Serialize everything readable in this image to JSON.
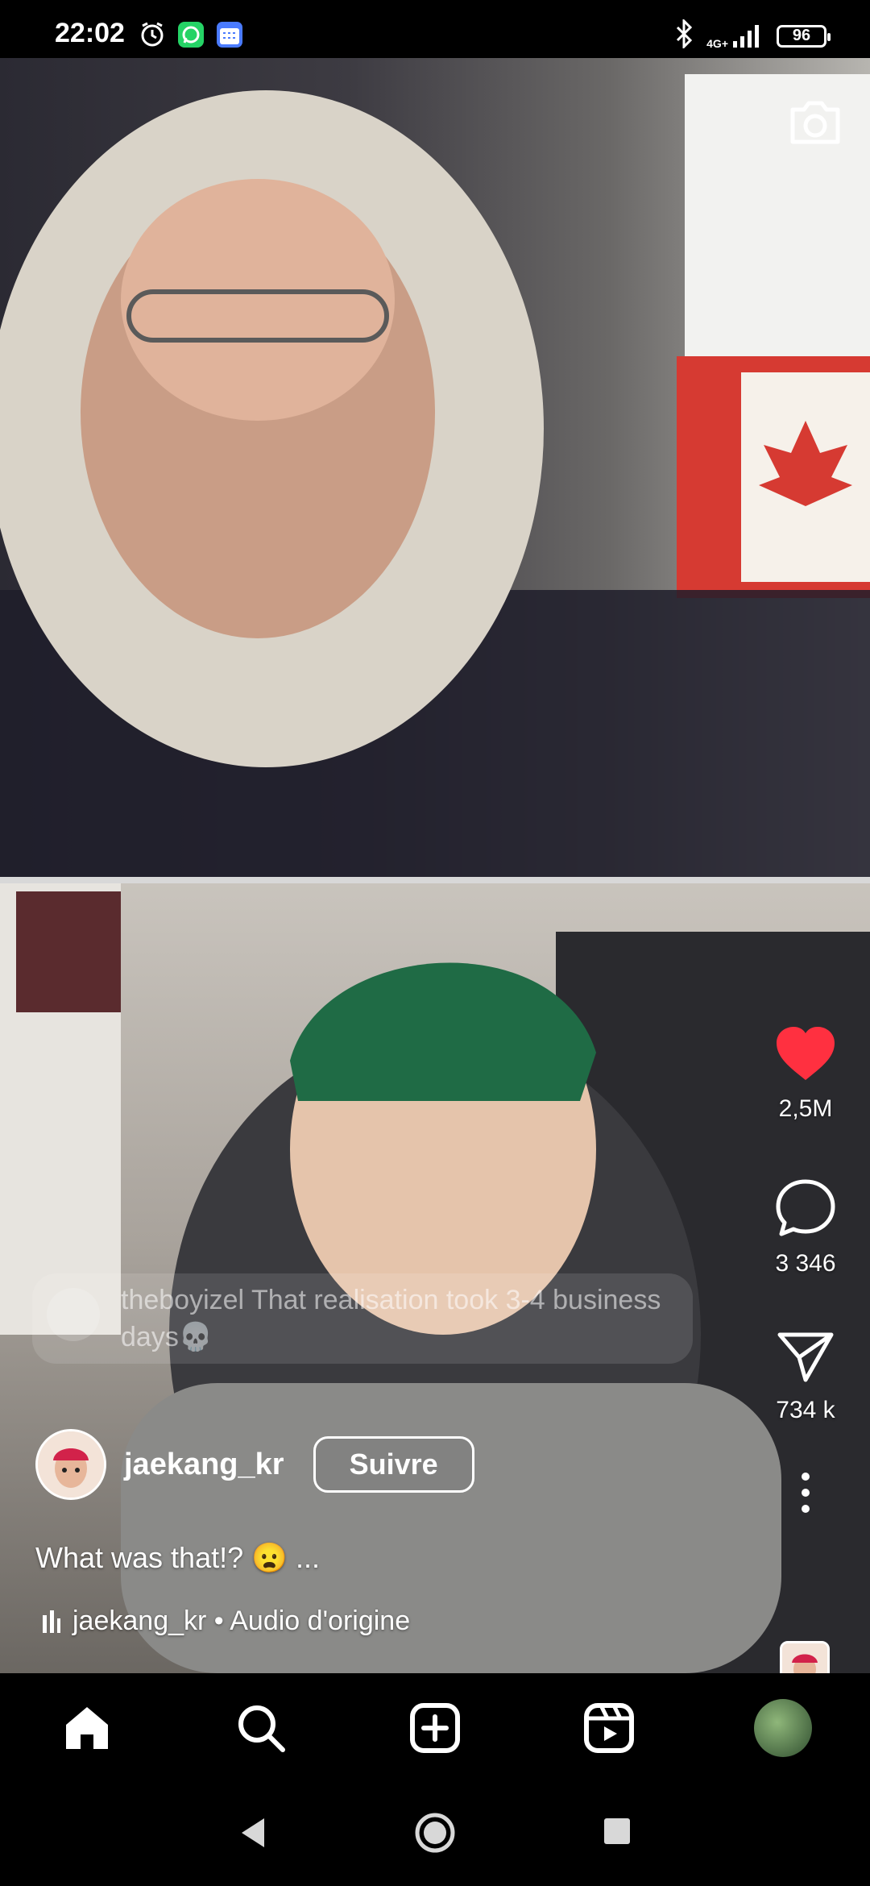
{
  "status_bar": {
    "time": "22:02",
    "network": "4G+",
    "battery": "96"
  },
  "video": {
    "overlay_comment": {
      "user": "theboyizel",
      "text": "That realisation took 3-4 business days💀"
    }
  },
  "actions": {
    "likes": "2,5M",
    "comments": "3 346",
    "shares": "734 k"
  },
  "author": {
    "username": "jaekang_kr",
    "follow_label": "Suivre"
  },
  "caption": "What was that!? 😦 ...",
  "audio": {
    "text": "jaekang_kr • Audio d'origine"
  },
  "colors": {
    "like_red": "#ff3040",
    "background": "#000000",
    "text": "#ffffff"
  },
  "icons": {
    "status_left": [
      "alarm-icon",
      "whatsapp-icon",
      "calendar-icon"
    ],
    "status_right": [
      "bluetooth-icon",
      "signal-icon",
      "battery-icon"
    ],
    "nav": [
      "home-icon",
      "search-icon",
      "create-icon",
      "reels-icon",
      "profile-avatar"
    ],
    "system": [
      "back-icon",
      "home-circle-icon",
      "recents-icon"
    ]
  }
}
